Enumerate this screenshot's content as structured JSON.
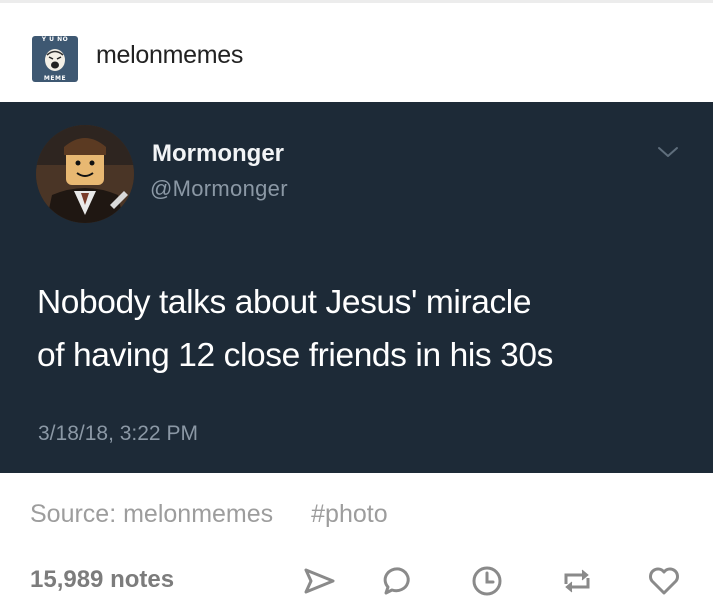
{
  "post": {
    "blog_name": "melonmemes",
    "blog_avatar_text_top": "Y U NO",
    "blog_avatar_text_bottom": "MEME"
  },
  "tweet": {
    "display_name": "Mormonger",
    "handle": "@Mormonger",
    "text_lines": [
      "Nobody talks about Jesus' miracle",
      "of having 12 close friends in his 30s"
    ],
    "timestamp": "3/18/18, 3:22 PM",
    "avatar_icon": "lego-minifigure-avatar",
    "colors": {
      "background": "#1d2a37",
      "secondary_text": "#8b98a5"
    }
  },
  "footer": {
    "source_label": "Source: melonmemes",
    "tag": "#photo",
    "notes": "15,989 notes",
    "actions": [
      {
        "name": "share",
        "icon": "paper-plane-icon"
      },
      {
        "name": "reply",
        "icon": "speech-bubble-icon"
      },
      {
        "name": "queue",
        "icon": "clock-icon"
      },
      {
        "name": "reblog",
        "icon": "reblog-arrows-icon"
      },
      {
        "name": "like",
        "icon": "heart-icon"
      }
    ]
  }
}
